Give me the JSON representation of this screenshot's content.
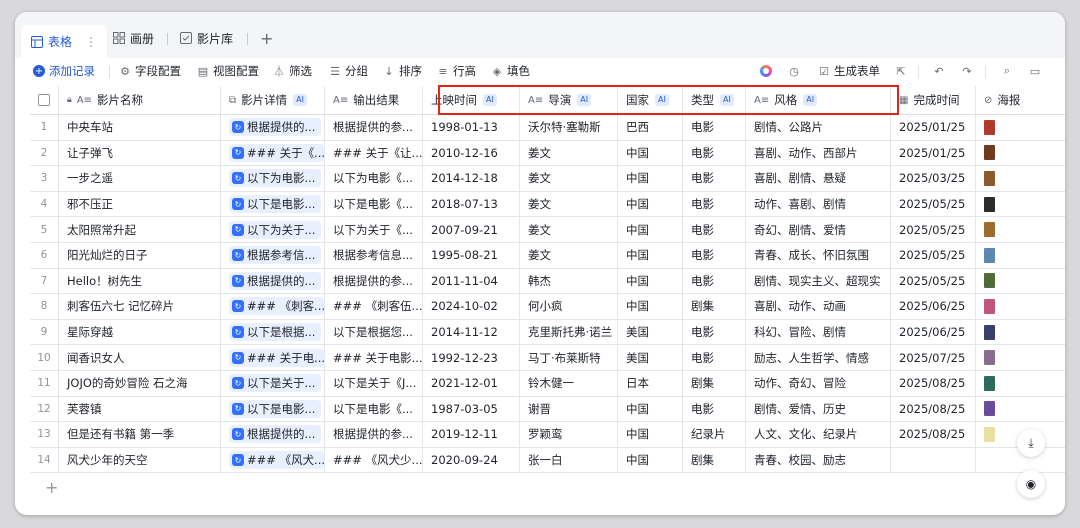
{
  "tabs": [
    {
      "label": "表格",
      "icon": "table-icon",
      "more": "⋮"
    },
    {
      "label": "画册",
      "icon": "gallery-icon"
    },
    {
      "label": "影片库",
      "icon": "form-icon"
    }
  ],
  "add_tab": "+",
  "toolbar": {
    "add_record": "添加记录",
    "field_config": "字段配置",
    "view_config": "视图配置",
    "filter": "筛选",
    "group": "分组",
    "sort": "排序",
    "row_height": "行高",
    "fill": "填色",
    "generate_form": "生成表单"
  },
  "columns": [
    {
      "label": "影片名称",
      "icon": "A≡",
      "lock": true
    },
    {
      "label": "影片详情",
      "icon": "⧉",
      "ai": "AI"
    },
    {
      "label": "输出结果",
      "icon": "A≡"
    },
    {
      "label": "上映时间",
      "ai": "AI"
    },
    {
      "label": "导演",
      "icon": "A≡",
      "ai": "AI"
    },
    {
      "label": "国家",
      "ai": "AI"
    },
    {
      "label": "类型",
      "ai": "AI"
    },
    {
      "label": "风格",
      "icon": "A≡",
      "ai": "AI"
    },
    {
      "label": "完成时间",
      "icon": "▦"
    },
    {
      "label": "海报",
      "icon": "⊘"
    }
  ],
  "rows": [
    {
      "n": "1",
      "name": "中央车站",
      "detail": "根据提供的...",
      "output": "根据提供的参...",
      "date": "1998-01-13",
      "director": "沃尔特·塞勒斯",
      "country": "巴西",
      "type": "电影",
      "style": "剧情、公路片",
      "done": "2025/01/25",
      "poster": "#b03a2e"
    },
    {
      "n": "2",
      "name": "让子弹飞",
      "detail": "### 关于《...",
      "output": "### 关于《让...",
      "date": "2010-12-16",
      "director": "姜文",
      "country": "中国",
      "type": "电影",
      "style": "喜剧、动作、西部片",
      "done": "2025/01/25",
      "poster": "#6e3b1f"
    },
    {
      "n": "3",
      "name": "一步之遥",
      "detail": "以下为电影...",
      "output": "以下为电影《...",
      "date": "2014-12-18",
      "director": "姜文",
      "country": "中国",
      "type": "电影",
      "style": "喜剧、剧情、悬疑",
      "done": "2025/03/25",
      "poster": "#8a5a2b"
    },
    {
      "n": "4",
      "name": "邪不压正",
      "detail": "以下是电影...",
      "output": "以下是电影《...",
      "date": "2018-07-13",
      "director": "姜文",
      "country": "中国",
      "type": "电影",
      "style": "动作、喜剧、剧情",
      "done": "2025/05/25",
      "poster": "#2c2c2c"
    },
    {
      "n": "5",
      "name": "太阳照常升起",
      "detail": "以下为关于...",
      "output": "以下为关于《...",
      "date": "2007-09-21",
      "director": "姜文",
      "country": "中国",
      "type": "电影",
      "style": "奇幻、剧情、爱情",
      "done": "2025/05/25",
      "poster": "#9b6b2f"
    },
    {
      "n": "6",
      "name": "阳光灿烂的日子",
      "detail": "根据参考信...",
      "output": "根据参考信息...",
      "date": "1995-08-21",
      "director": "姜文",
      "country": "中国",
      "type": "电影",
      "style": "青春、成长、怀旧氛围",
      "done": "2025/05/25",
      "poster": "#5b87b0"
    },
    {
      "n": "7",
      "name": "Hello！树先生",
      "detail": "根据提供的...",
      "output": "根据提供的参...",
      "date": "2011-11-04",
      "director": "韩杰",
      "country": "中国",
      "type": "电影",
      "style": "剧情、现实主义、超现实",
      "done": "2025/05/25",
      "poster": "#4f6b3a"
    },
    {
      "n": "8",
      "name": "刺客伍六七 记忆碎片",
      "detail": "### 《刺客...",
      "output": "### 《刺客伍...",
      "date": "2024-10-02",
      "director": "何小疯",
      "country": "中国",
      "type": "剧集",
      "style": "喜剧、动作、动画",
      "done": "2025/06/25",
      "poster": "#c2557a"
    },
    {
      "n": "9",
      "name": "星际穿越",
      "detail": "以下是根据...",
      "output": "以下是根据您...",
      "date": "2014-11-12",
      "director": "克里斯托弗·诺兰",
      "country": "美国",
      "type": "电影",
      "style": "科幻、冒险、剧情",
      "done": "2025/06/25",
      "poster": "#3a3f6b"
    },
    {
      "n": "10",
      "name": "闻香识女人",
      "detail": "### 关于电...",
      "output": "### 关于电影...",
      "date": "1992-12-23",
      "director": "马丁·布莱斯特",
      "country": "美国",
      "type": "电影",
      "style": "励志、人生哲学、情感",
      "done": "2025/07/25",
      "poster": "#8b6b8f"
    },
    {
      "n": "11",
      "name": "JOJO的奇妙冒险 石之海",
      "detail": "以下是关于...",
      "output": "以下是关于《J...",
      "date": "2021-12-01",
      "director": "铃木健一",
      "country": "日本",
      "type": "剧集",
      "style": "动作、奇幻、冒险",
      "done": "2025/08/25",
      "poster": "#2f6b5a"
    },
    {
      "n": "12",
      "name": "芙蓉镇",
      "detail": "以下是电影...",
      "output": "以下是电影《...",
      "date": "1987-03-05",
      "director": "谢晋",
      "country": "中国",
      "type": "电影",
      "style": "剧情、爱情、历史",
      "done": "2025/08/25",
      "poster": "#6a4a9b"
    },
    {
      "n": "13",
      "name": "但是还有书籍 第一季",
      "detail": "根据提供的...",
      "output": "根据提供的参...",
      "date": "2019-12-11",
      "director": "罗颖鸾",
      "country": "中国",
      "type": "纪录片",
      "style": "人文、文化、纪录片",
      "done": "2025/08/25",
      "poster": "#e8e0a0"
    },
    {
      "n": "14",
      "name": "风犬少年的天空",
      "detail": "### 《风犬...",
      "output": "### 《风犬少...",
      "date": "2020-09-24",
      "director": "张一白",
      "country": "中国",
      "type": "剧集",
      "style": "青春、校园、励志",
      "done": "",
      "poster": ""
    }
  ],
  "add_row": "+"
}
